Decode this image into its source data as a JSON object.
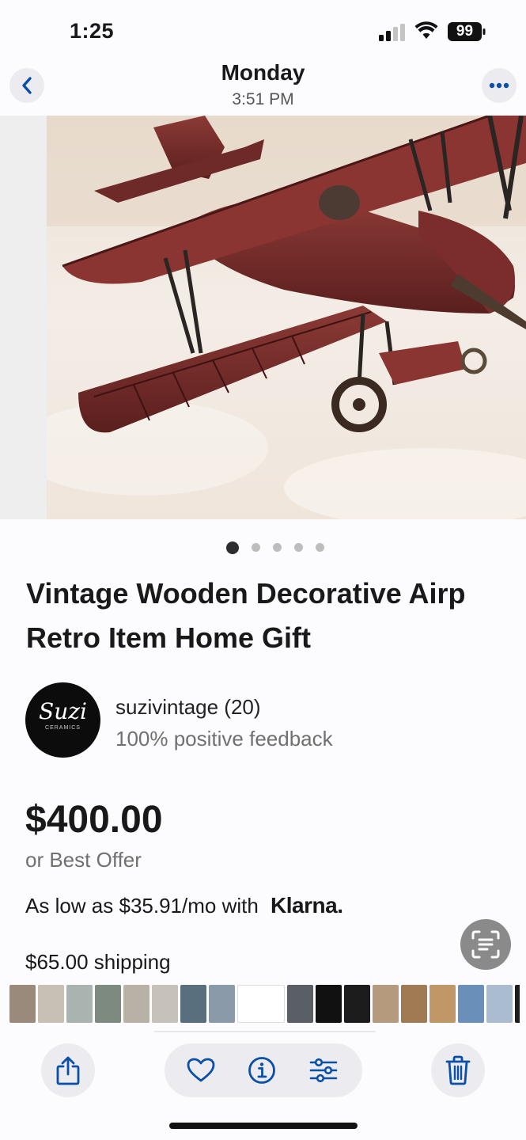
{
  "status_bar": {
    "time": "1:25",
    "battery": "99"
  },
  "photo_header": {
    "title": "Monday",
    "subtitle": "3:51 PM"
  },
  "image": {
    "dots_total": 5,
    "dots_active_index": 0
  },
  "listing": {
    "title_line1": "Vintage Wooden Decorative Airp",
    "title_line2": "Retro Item Home Gift",
    "seller_name": "suzivintage (20)",
    "seller_feedback": "100% positive feedback",
    "avatar_text": "Suzi",
    "avatar_subtext": "CERAMICS",
    "price": "$400.00",
    "best_offer": "or Best Offer",
    "klarna_prefix": "As low as $35.91/mo with",
    "klarna_logo": "Klarna.",
    "shipping": "$65.00 shipping"
  },
  "colors": {
    "accent": "#0a4fa8",
    "ink": "#191919",
    "muted": "#707070"
  },
  "thumbnails": [
    "#9a8a7c",
    "#c8c0b4",
    "#a9b4b0",
    "#7d8a7f",
    "#b8b2a6",
    "#c7c2b9",
    "#5a6f7e",
    "#8b9aa8",
    "#2b2b2b",
    "#5a5f66",
    "#111111",
    "#1c1c1c",
    "#b69a7e",
    "#a07a52",
    "#c19768",
    "#6a8fb8",
    "#a9bcd0",
    "#1d1d1d",
    "#c9b09a"
  ],
  "toolbar": {
    "share_icon": "share-icon",
    "favorite_icon": "heart-icon",
    "info_icon": "info-icon",
    "adjust_icon": "sliders-icon",
    "delete_icon": "trash-icon"
  }
}
